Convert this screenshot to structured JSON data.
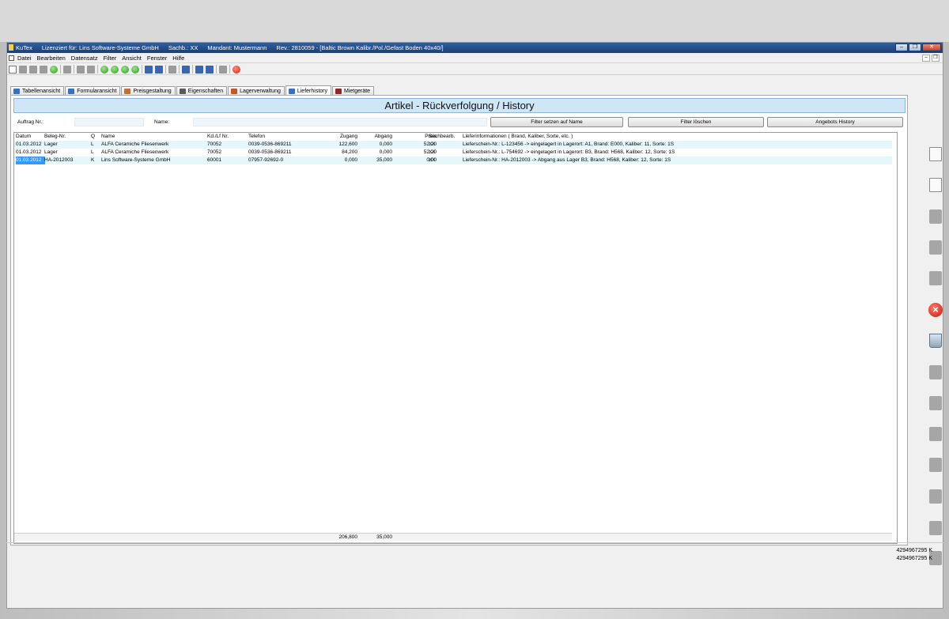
{
  "window": {
    "app_name": "KuTex",
    "license": "Lizenziert für: Lins Software-Systeme GmbH",
    "sachb": "Sachb.: XX",
    "mandant": "Mandant: Mustermann",
    "rev": "Rev.: 2810059 - [Baltic Brown Kalibr./Pol./Gefast Boden 40x40/]"
  },
  "menu": [
    "Datei",
    "Bearbeiten",
    "Datensatz",
    "Filter",
    "Ansicht",
    "Fenster",
    "Hilfe"
  ],
  "tabs": [
    {
      "label": "Tabellenansicht",
      "icon": "table-icon",
      "color": "#3b6fc0"
    },
    {
      "label": "Formularansicht",
      "icon": "form-icon",
      "color": "#3b6fc0"
    },
    {
      "label": "Preisgestaltung",
      "icon": "price-icon",
      "color": "#c0703b"
    },
    {
      "label": "Eigenschaften",
      "icon": "properties-icon",
      "color": "#5a5a5a"
    },
    {
      "label": "Lagerverwaltung",
      "icon": "warehouse-icon",
      "color": "#c05a2a"
    },
    {
      "label": "Lieferhistory",
      "icon": "history-icon",
      "color": "#3b6fc0",
      "active": true
    },
    {
      "label": "Mietgeräte",
      "icon": "rental-icon",
      "color": "#8a2a2a"
    }
  ],
  "banner": "Artikel - Rückverfolgung / History",
  "filter": {
    "auftrag_label": "Auftrag Nr.:",
    "name_label": "Name:",
    "btn_set": "Filter setzen auf Name",
    "btn_clear": "Filter löschen",
    "btn_offers": "Angebots History"
  },
  "table": {
    "headers": [
      "Datum",
      "Beleg-Nr.",
      "Q",
      "Name",
      "Kd./Lf Nr.",
      "Telefon",
      "Zugang",
      "Abgang",
      "Preis",
      "Sachbearb.",
      "Lieferinformationen ( Brand, Kaliber, Sorte, etc. )"
    ],
    "rows": [
      [
        "01.03.2012",
        "Lager",
        "L",
        "ALFA Ceramiche Fliesenwerk",
        "70052",
        "0039-0536-869211",
        "122,600",
        "0,000",
        "52,20",
        "XX",
        "Lieferschein-Nr.:  L-123456 -> eingelagert in Lagerort: A1, Brand: E000, Kaliber: 11, Sorte: 1S"
      ],
      [
        "01.03.2012",
        "Lager",
        "L",
        "ALFA Ceramiche Fliesenwerk",
        "70052",
        "0039-0536-869211",
        "84,200",
        "0,000",
        "52,20",
        "XX",
        "Lieferschein-Nr.:  L-754692 -> eingelagert in Lagerort: B3, Brand: H568, Kaliber: 12, Sorte: 1S"
      ],
      [
        "01.03.2012",
        "HA-2012003",
        "K",
        "Lins Software-Systeme GmbH",
        "60001",
        "07957-92692-0",
        "0,000",
        "35,000",
        "0,00",
        "XX",
        "Lieferschein-Nr.: HA-2012003 -> Abgang aus Lager B3, Brand: H568, Kaliber: 12, Sorte: 1S"
      ]
    ],
    "totals": {
      "zugang": "206,800",
      "abgang": "35,000"
    }
  },
  "status": {
    "line1": "4294967295 K",
    "line2": "4294967295 K"
  }
}
